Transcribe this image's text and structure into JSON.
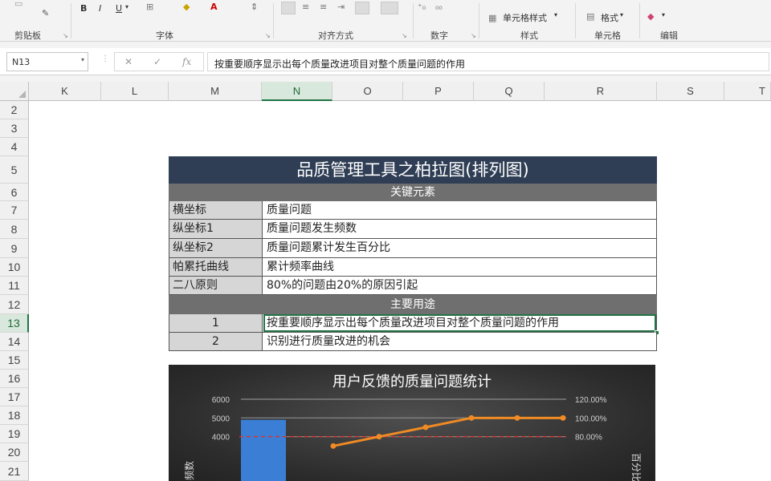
{
  "ribbon": {
    "groups": [
      "剪贴板",
      "字体",
      "对齐方式",
      "数字",
      "样式",
      "单元格",
      "编辑"
    ],
    "buttons": {
      "bold": "B",
      "italic": "I",
      "underline": "U",
      "cell_style": "单元格样式",
      "format": "格式",
      "percent": "%"
    }
  },
  "formula_bar": {
    "name_box": "N13",
    "cancel": "✕",
    "enter": "✓",
    "fx": "fx",
    "content": "按重要顺序显示出每个质量改进项目对整个质量问题的作用"
  },
  "columns": [
    "K",
    "L",
    "M",
    "N",
    "O",
    "P",
    "Q",
    "R",
    "S",
    "T"
  ],
  "rows": [
    "2",
    "3",
    "4",
    "5",
    "6",
    "7",
    "8",
    "9",
    "10",
    "11",
    "12",
    "13",
    "14",
    "15",
    "16",
    "17",
    "18",
    "19",
    "20",
    "21"
  ],
  "table": {
    "title": "品质管理工具之柏拉图(排列图)",
    "section1": "关键元素",
    "elements": [
      {
        "key": "横坐标",
        "value": "质量问题"
      },
      {
        "key": "纵坐标1",
        "value": "质量问题发生频数"
      },
      {
        "key": "纵坐标2",
        "value": "质量问题累计发生百分比"
      },
      {
        "key": "帕累托曲线",
        "value": "累计频率曲线"
      },
      {
        "key": "二八原则",
        "value": "80%的问题由20%的原因引起"
      }
    ],
    "section2": "主要用途",
    "uses": [
      {
        "key": "1",
        "value": "按重要顺序显示出每个质量改进项目对整个质量问题的作用"
      },
      {
        "key": "2",
        "value": "识别进行质量改进的机会"
      }
    ]
  },
  "chart_data": {
    "type": "bar",
    "title": "用户反馈的质量问题统计",
    "y_left_ticks": [
      "6000",
      "5000",
      "4000"
    ],
    "y_right_ticks": [
      "120.00%",
      "100.00%",
      "80.00%"
    ],
    "ylim_left": [
      0,
      6000
    ],
    "ylim_right": [
      0,
      1.2
    ],
    "ylabel_left": "频数",
    "ylabel_right": "百分比",
    "series": [
      {
        "type": "bar",
        "values": [
          4900
        ]
      },
      {
        "type": "line",
        "values": [
          0.7,
          0.8,
          0.9,
          1.0,
          1.0,
          1.0
        ]
      }
    ],
    "reference_line": 0.8,
    "colors": {
      "bar": "#3a7fd5",
      "line": "#f08a24",
      "ref": "#d9342b",
      "grid": "#8c8c8c"
    }
  }
}
